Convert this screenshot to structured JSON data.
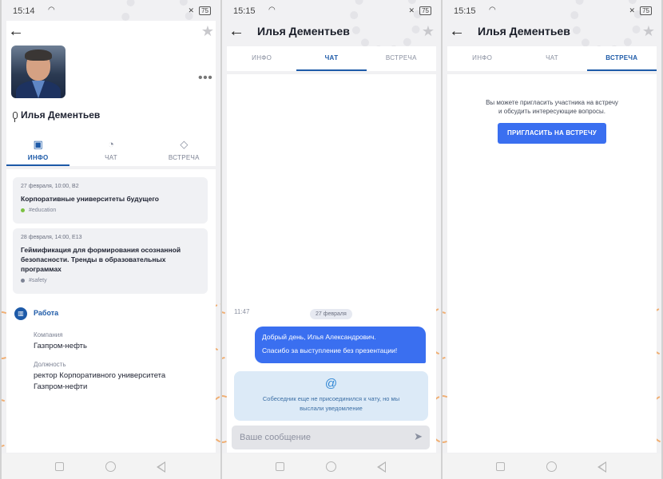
{
  "panels": [
    {
      "time": "15:14",
      "battery": "75",
      "profile": {
        "name": "Илья Дементьев",
        "tabs": [
          {
            "label": "ИНФО",
            "icon": "id-card-icon",
            "active": true
          },
          {
            "label": "ЧАТ",
            "icon": "chat-bubble-icon",
            "active": false
          },
          {
            "label": "ВСТРЕЧА",
            "icon": "handshake-icon",
            "active": false
          }
        ],
        "events": [
          {
            "meta": "27 февраля, 10:00, B2",
            "title": "Корпоративные университеты будущего",
            "tag": "#education",
            "tag_color": "#7cc142"
          },
          {
            "meta": "28 февраля, 14:00, E13",
            "title": "Геймификация для формирования осознанной безопасности. Тренды в образовательных программах",
            "tag": "#safety",
            "tag_color": "#7d8394"
          }
        ],
        "work": {
          "heading": "Работа",
          "company_label": "Компания",
          "company": "Газпром-нефть",
          "position_label": "Должность",
          "position": "ректор Корпоративного университета Газпром-нефти"
        }
      }
    },
    {
      "time": "15:15",
      "battery": "75",
      "header_name": "Илья Дементьев",
      "tabs": [
        {
          "label": "ИНФО",
          "active": false
        },
        {
          "label": "ЧАТ",
          "active": true
        },
        {
          "label": "ВСТРЕЧА",
          "active": false
        }
      ],
      "chat": {
        "time": "11:47",
        "date": "27 февраля",
        "message_line1": "Добрый день, Илья Александрович.",
        "message_line2": "Спасибо за выступление без презентации!",
        "notice": "Собеседник еще не присоединился к чату, но мы выслали уведомление",
        "input_placeholder": "Ваше сообщение"
      }
    },
    {
      "time": "15:15",
      "battery": "75",
      "header_name": "Илья Дементьев",
      "tabs": [
        {
          "label": "ИНФО",
          "active": false
        },
        {
          "label": "ЧАТ",
          "active": false
        },
        {
          "label": "ВСТРЕЧА",
          "active": true
        }
      ],
      "meeting": {
        "text_line1": "Вы можете пригласить участника на встречу",
        "text_line2": "и обсудить интересующие вопросы.",
        "button": "ПРИГЛАСИТЬ НА ВСТРЕЧУ"
      }
    }
  ],
  "colors": {
    "accent": "#1d5aa8",
    "button": "#3a6ff0",
    "notice_bg": "#dceaf7",
    "deco_orange": "#f09a4a"
  }
}
